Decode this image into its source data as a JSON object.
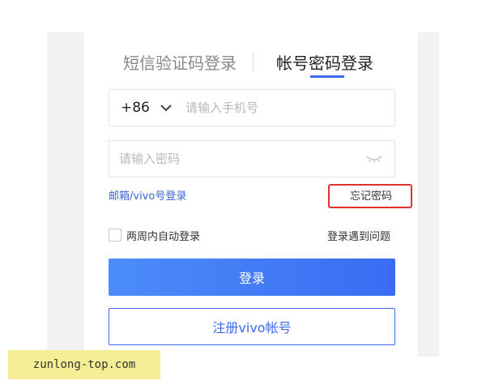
{
  "tabs": {
    "sms_login": "短信验证码登录",
    "password_login": "帐号密码登录",
    "active": "password_login"
  },
  "phone": {
    "country_code": "+86",
    "placeholder": "请输入手机号",
    "value": ""
  },
  "password": {
    "placeholder": "请输入密码",
    "value": ""
  },
  "links": {
    "email_vivo_login": "邮箱/vivo号登录",
    "forgot_password": "忘记密码",
    "login_problem": "登录遇到问题"
  },
  "remember": {
    "label": "两周内自动登录",
    "checked": false
  },
  "buttons": {
    "login": "登录",
    "register": "注册vivo帐号"
  },
  "watermark": "zunlong-top.com",
  "colors": {
    "accent": "#3d6bf0",
    "highlight_box": "#e03030",
    "link": "#3a66d6"
  },
  "icons": {
    "country_dropdown": "chevron-down-icon",
    "password_visibility": "eye-closed-icon"
  }
}
